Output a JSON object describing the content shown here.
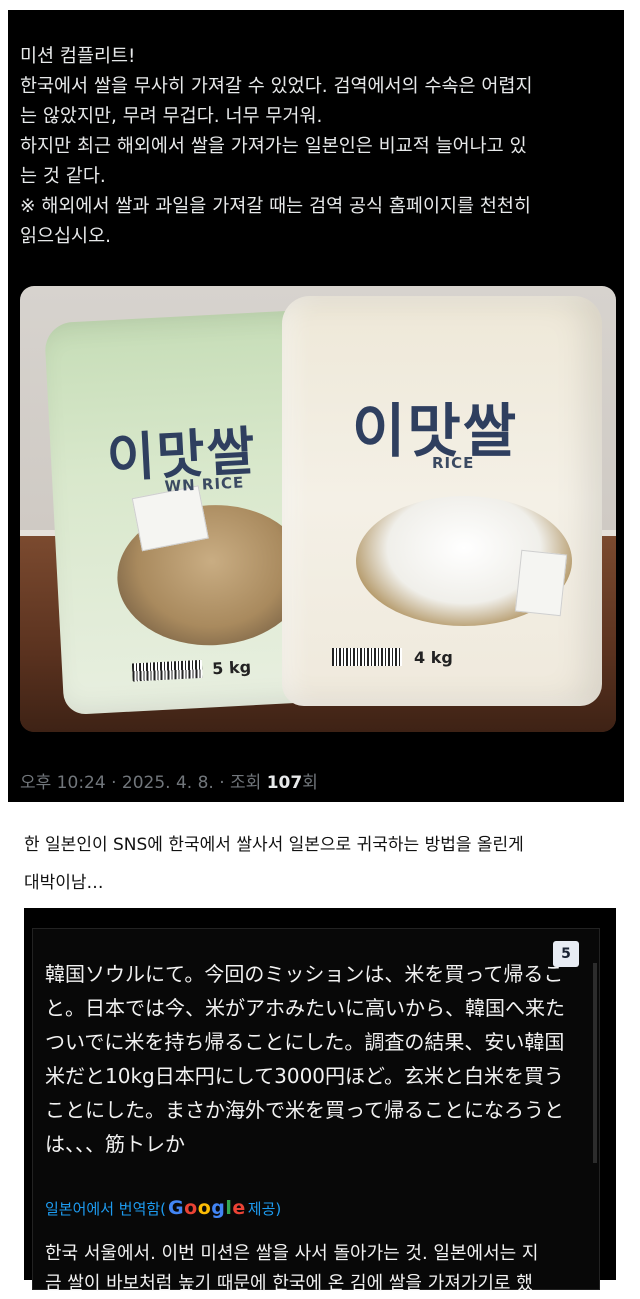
{
  "post1": {
    "body_lines": [
      "미션 컴플리트!",
      "한국에서 쌀을 무사히 가져갈 수 있었다. 검역에서의 수속은 어렵지",
      "는 않았지만, 무려 무겁다. 너무 무거워.",
      "하지만 최근 해외에서 쌀을 가져가는 일본인은 비교적 늘어나고 있",
      "는 것 같다.",
      "※ 해외에서 쌀과 과일을 가져갈 때는 검역 공식 홈페이지를 천천히",
      "읽으십시오."
    ],
    "photo": {
      "left_bag": {
        "title": "이맛쌀",
        "subtitle": "WN RICE",
        "weight": "5 kg"
      },
      "right_bag": {
        "title": "이맛쌀",
        "subtitle": "RICE",
        "weight": "4 kg"
      }
    },
    "meta": {
      "time_date": "오후 10:24 · 2025. 4. 8. · 조회 ",
      "views": "107",
      "views_suffix": "회"
    }
  },
  "caption": "한 일본인이 SNS에 한국에서 쌀사서 일본으로 귀국하는 방법을 올린게\n대박이남…",
  "post2": {
    "badge": "5",
    "jp_lines": [
      "韓国ソウルにて。今回のミッションは、米を買って帰るこ",
      "と。日本では今、米がアホみたいに高いから、韓国へ来た",
      "ついでに米を持ち帰ることにした。調査の結果、安い韓国",
      "米だと10kg日本円にして3000円ほど。玄米と白米を買う",
      "ことにした。まさか海外で米を買って帰ることになろうと",
      "は、、、筋トレか"
    ],
    "translated_prefix": "일본어에서 번역함(",
    "google_word": [
      "G",
      "o",
      "o",
      "g",
      "l",
      "e"
    ],
    "translated_suffix": " 제공)",
    "kr_lines": [
      "한국 서울에서. 이번 미션은 쌀을 사서 돌아가는 것. 일본에서는 지",
      "금 쌀이 바보처럼 높기 때문에 한국에 온 김에 쌀을 가져가기로 했"
    ]
  }
}
